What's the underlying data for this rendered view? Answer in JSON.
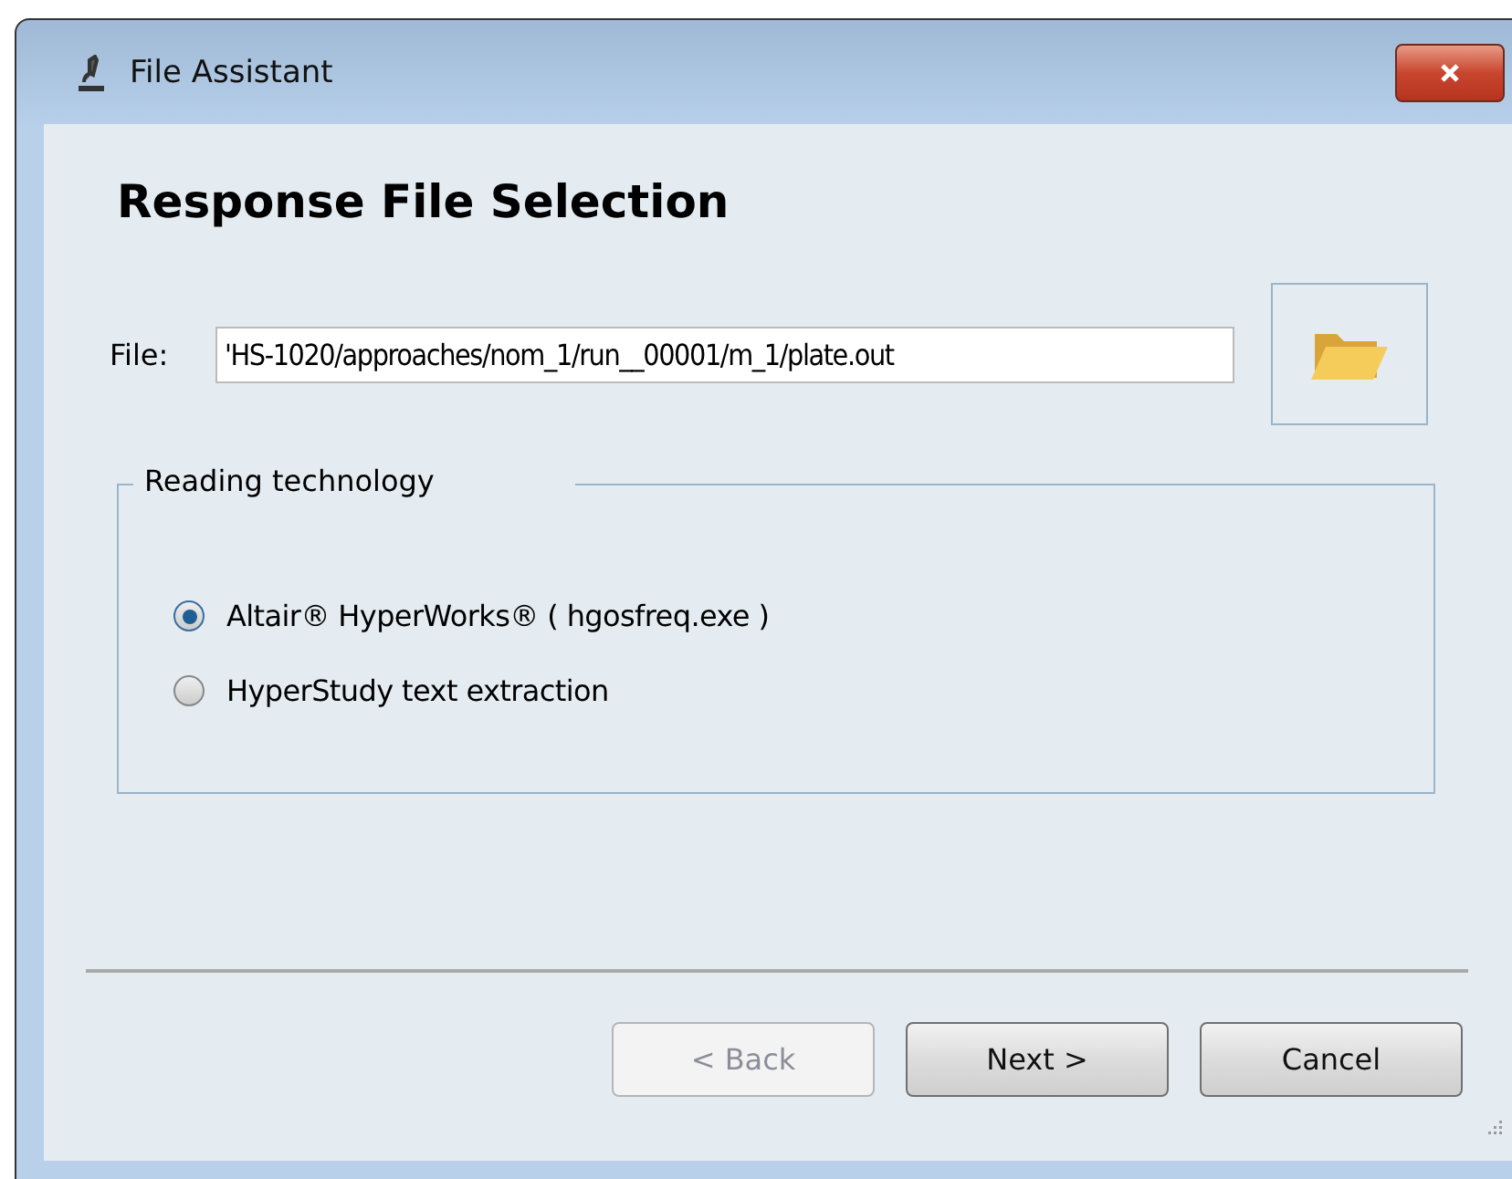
{
  "window": {
    "title": "File Assistant"
  },
  "heading": "Response File Selection",
  "file": {
    "label": "File:",
    "value": "'HS-1020/approaches/nom_1/run__00001/m_1/plate.out"
  },
  "group": {
    "title": "Reading technology",
    "options": [
      {
        "label": "Altair® HyperWorks® ( hgosfreq.exe )",
        "selected": true
      },
      {
        "label": "HyperStudy text extraction",
        "selected": false
      }
    ]
  },
  "buttons": [
    {
      "label": "< Back",
      "disabled": true
    },
    {
      "label": "Next >",
      "disabled": false
    },
    {
      "label": "Cancel",
      "disabled": false
    }
  ]
}
